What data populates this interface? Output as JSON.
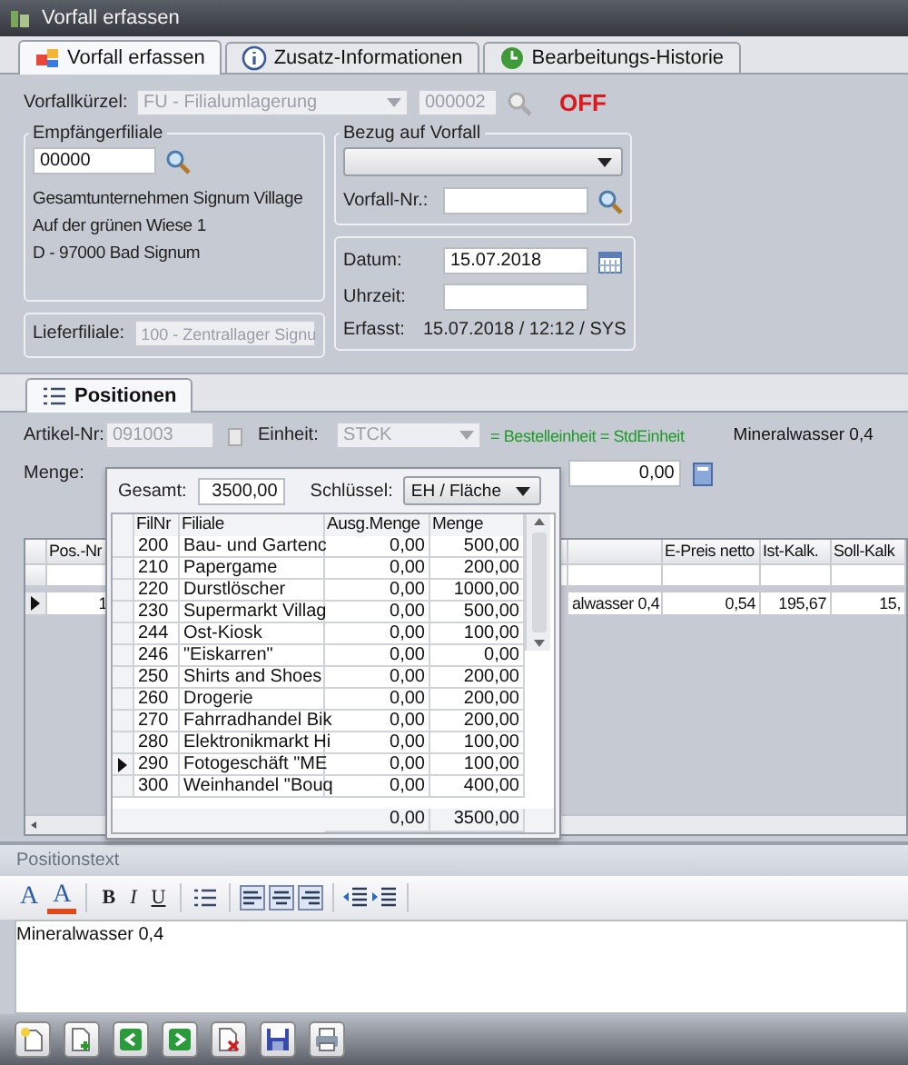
{
  "window": {
    "title": "Vorfall erfassen"
  },
  "tabs": [
    {
      "label": "Vorfall erfassen",
      "selected": true
    },
    {
      "label": "Zusatz-Informationen",
      "selected": false
    },
    {
      "label": "Bearbeitungs-Historie",
      "selected": false
    }
  ],
  "vorfall": {
    "label": "Vorfallkürzel:",
    "value": "FU - Filialumlagerung",
    "number": "000002",
    "status": "OFF",
    "disabled": true
  },
  "empfaenger": {
    "title": "Empfängerfiliale",
    "value": "00000",
    "address": [
      "Gesamtunternehmen Signum Village",
      "Auf der grünen Wiese 1",
      "D - 97000 Bad Signum"
    ]
  },
  "lieferfiliale": {
    "label": "Lieferfiliale:",
    "value": "100 - Zentrallager Signu",
    "disabled": true
  },
  "bezug": {
    "title": "Bezug auf Vorfall",
    "number_label": "Vorfall-Nr.:"
  },
  "datum": {
    "date_label": "Datum:",
    "date_value": "15.07.2018",
    "time_label": "Uhrzeit:",
    "captured_label": "Erfasst:",
    "captured_value": "15.07.2018 / 12:12 / SYS"
  },
  "section_tabs": [
    {
      "label": "Positionen",
      "selected": true
    }
  ],
  "article": {
    "number_label": "Artikel-Nr:",
    "number_value": "091003",
    "unit_label": "Einheit:",
    "unit_value": "STCK",
    "unit_note": "= Bestelleinheit = StdEinheit",
    "description": "Mineralwasser 0,4",
    "quantity_label": "Menge:",
    "quantity_value": "0,00"
  },
  "grid": {
    "columns": [
      "Pos.-Nr",
      "",
      "E-Preis netto",
      "Ist-Kalk.",
      "Soll-Kalk"
    ],
    "rows": [
      {
        "selected": true,
        "cells": [
          "1",
          "alwasser 0,4",
          "0,54",
          "195,67",
          "15,"
        ]
      }
    ]
  },
  "allocation": {
    "total_label": "Gesamt:",
    "total_value": "3500,00",
    "key_label": "Schlüssel:",
    "key_value": "EH / Fläche",
    "columns": [
      "FilNr",
      "Filiale",
      "Ausg.Menge",
      "Menge"
    ],
    "rows": [
      {
        "filnr": "200",
        "filiale": "Bau- und Gartenc",
        "ausg": "0,00",
        "menge": "500,00",
        "selected": false
      },
      {
        "filnr": "210",
        "filiale": "Papergame",
        "ausg": "0,00",
        "menge": "200,00",
        "selected": false
      },
      {
        "filnr": "220",
        "filiale": "Durstlöscher",
        "ausg": "0,00",
        "menge": "1000,00",
        "selected": false
      },
      {
        "filnr": "230",
        "filiale": "Supermarkt Villag",
        "ausg": "0,00",
        "menge": "500,00",
        "selected": false
      },
      {
        "filnr": "244",
        "filiale": "Ost-Kiosk",
        "ausg": "0,00",
        "menge": "100,00",
        "selected": false
      },
      {
        "filnr": "246",
        "filiale": "\"Eiskarren\"",
        "ausg": "0,00",
        "menge": "0,00",
        "selected": false
      },
      {
        "filnr": "250",
        "filiale": "Shirts and Shoes",
        "ausg": "0,00",
        "menge": "200,00",
        "selected": false
      },
      {
        "filnr": "260",
        "filiale": "Drogerie",
        "ausg": "0,00",
        "menge": "200,00",
        "selected": false
      },
      {
        "filnr": "270",
        "filiale": "Fahrradhandel Bik",
        "ausg": "0,00",
        "menge": "200,00",
        "selected": false
      },
      {
        "filnr": "280",
        "filiale": "Elektronikmarkt Hi",
        "ausg": "0,00",
        "menge": "100,00",
        "selected": false
      },
      {
        "filnr": "290",
        "filiale": "Fotogeschäft \"ME",
        "ausg": "0,00",
        "menge": "100,00",
        "selected": true
      },
      {
        "filnr": "300",
        "filiale": "Weinhandel \"Bouq",
        "ausg": "0,00",
        "menge": "400,00",
        "selected": false
      }
    ],
    "totals": {
      "ausg": "0,00",
      "menge": "3500,00"
    }
  },
  "position_text": {
    "title": "Positionstext",
    "text": "Mineralwasser 0,4",
    "format_buttons": [
      {
        "label": "A",
        "kind": "font"
      },
      {
        "label": "A",
        "kind": "color"
      },
      {
        "label": "B",
        "kind": "bold"
      },
      {
        "label": "I",
        "kind": "italic"
      },
      {
        "label": "U",
        "kind": "underline"
      }
    ]
  }
}
